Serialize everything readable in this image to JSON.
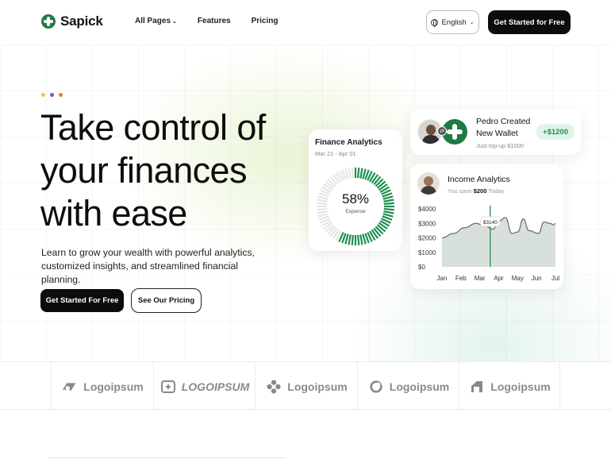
{
  "nav": {
    "brand": "Sapick",
    "links": [
      "All Pages",
      "Features",
      "Pricing"
    ],
    "language": "English",
    "cta": "Get Started for Free"
  },
  "hero": {
    "dot_colors": [
      "#f4c430",
      "#7b4fd6",
      "#f07a2a"
    ],
    "title": "Take control of your finances with ease",
    "subtitle": "Learn to grow your wealth with powerful analytics, customized insights, and streamlined financial planning.",
    "primary_button": "Get Started For Free",
    "secondary_button": "See Our Pricing"
  },
  "finance_card": {
    "title": "Finance Analytics",
    "date_range": "Mar 21 - Apr 01",
    "percent": "58%",
    "label": "Expense",
    "fill_fraction": 0.58
  },
  "wallet_card": {
    "title": "Pedro Created New Wallet",
    "subtitle": "Just top-up $1000",
    "amount": "+$1200"
  },
  "income_card": {
    "title": "Income Analytics",
    "subtitle_prefix": "You save",
    "subtitle_amount": "$200",
    "subtitle_suffix": "Today",
    "tooltip": "$3140"
  },
  "chart_data": {
    "type": "area",
    "x": [
      "Jan",
      "Feb",
      "Mar",
      "Apr",
      "May",
      "Jun",
      "Jul"
    ],
    "y_ticks": [
      "$4000",
      "$3000",
      "$2000",
      "$1000",
      "$0"
    ],
    "ylim": [
      0,
      4000
    ],
    "series": [
      {
        "points": [
          [
            0,
            2000
          ],
          [
            0.6,
            2300
          ],
          [
            1.2,
            2700
          ],
          [
            1.8,
            3000
          ],
          [
            2.3,
            2800
          ],
          [
            2.7,
            2600
          ],
          [
            3.0,
            3140
          ],
          [
            3.35,
            3400
          ],
          [
            3.7,
            2300
          ],
          [
            4.0,
            2400
          ],
          [
            4.3,
            3300
          ],
          [
            4.6,
            2500
          ],
          [
            5.1,
            2300
          ],
          [
            5.4,
            3100
          ],
          [
            5.7,
            3000
          ],
          [
            5.9,
            2900
          ],
          [
            6.0,
            3000
          ]
        ]
      }
    ],
    "highlight_x": 2.55,
    "colors": {
      "line": "#6a6a6a",
      "fill": "#b7c7bd",
      "marker": "#1f8f4f"
    },
    "grid": false
  },
  "logos": [
    "Logoipsum",
    "LOGOIPSUM",
    "Logoipsum",
    "Logoipsum",
    "Logoipsum"
  ],
  "colors": {
    "brand_green": "#1f7a46",
    "accent_green": "#1f8f4f",
    "dark": "#0c0c0c"
  }
}
